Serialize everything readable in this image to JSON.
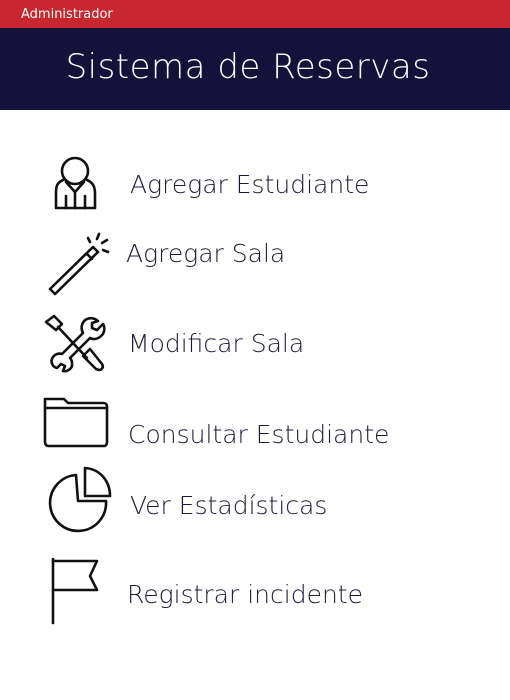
{
  "topbar": {
    "user_label": "Administrador"
  },
  "header": {
    "title": "Sistema de Reservas"
  },
  "menu": {
    "items": [
      {
        "label": "Agregar Estudiante",
        "icon": "user-icon"
      },
      {
        "label": "Agregar Sala",
        "icon": "magic-wand-icon"
      },
      {
        "label": "Modificar Sala",
        "icon": "tools-icon"
      },
      {
        "label": "Consultar Estudiante",
        "icon": "folder-icon"
      },
      {
        "label": "Ver Estadísticas",
        "icon": "pie-chart-icon"
      },
      {
        "label": "Registrar incidente",
        "icon": "flag-icon"
      }
    ]
  },
  "colors": {
    "topbar": "#c8272f",
    "header": "#14123a",
    "text": "#1c1b3a"
  }
}
